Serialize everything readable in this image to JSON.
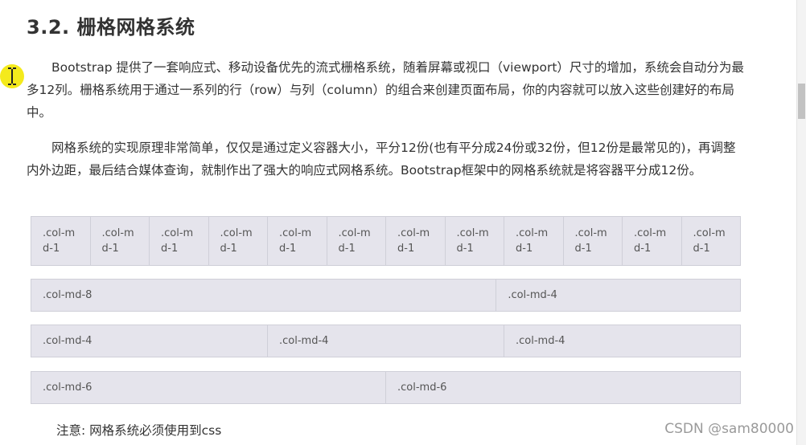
{
  "heading": "3.2. 栅格网格系统",
  "paragraphs": [
    "Bootstrap 提供了一套响应式、移动设备优先的流式栅格系统，随着屏幕或视口（viewport）尺寸的增加，系统会自动分为最多12列。栅格系统用于通过一系列的行（row）与列（column）的组合来创建页面布局，你的内容就可以放入这些创建好的布局中。",
    "网格系统的实现原理非常简单，仅仅是通过定义容器大小，平分12份(也有平分成24份或32份，但12份是最常见的)，再调整内外边距，最后结合媒体查询，就制作出了强大的响应式网格系统。Bootstrap框架中的网格系统就是将容器平分成12份。"
  ],
  "grid_rows": {
    "row_md1": [
      ".col-md-1",
      ".col-md-1",
      ".col-md-1",
      ".col-md-1",
      ".col-md-1",
      ".col-md-1",
      ".col-md-1",
      ".col-md-1",
      ".col-md-1",
      ".col-md-1",
      ".col-md-1",
      ".col-md-1"
    ],
    "row_8_4": [
      ".col-md-8",
      ".col-md-4"
    ],
    "row_4_4_4": [
      ".col-md-4",
      ".col-md-4",
      ".col-md-4"
    ],
    "row_6_6": [
      ".col-md-6",
      ".col-md-6"
    ]
  },
  "note": "注意: 网格系统必须使用到css",
  "watermark": "CSDN @sam80000",
  "colors": {
    "cell_bg": "#e5e4ec",
    "cell_border": "#cfcfd8",
    "cursor_highlight": "#f4ea1c"
  },
  "icons": {
    "cursor": "text-cursor-icon"
  }
}
